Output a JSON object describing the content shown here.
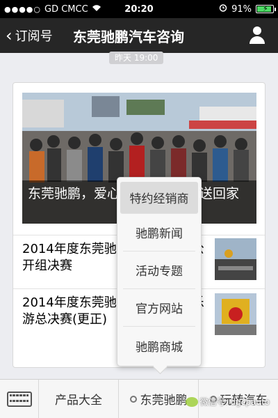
{
  "status_bar": {
    "carrier": "GD CMCC",
    "time": "20:20",
    "battery": "91%",
    "battery_level": 0.91
  },
  "nav": {
    "back_label": "订阅号",
    "title": "东莞驰鹏汽车咨询"
  },
  "timestamp": "昨天 19:00",
  "hero": {
    "caption": "东莞驰鹏，爱心车队为你平安送回家"
  },
  "news": [
    {
      "title": "2014年度东莞驰鹏汽车争霸赛公开组决赛"
    },
    {
      "title": "2014年度东莞驰鹏汽车丁车同乐游总决赛(更正)"
    }
  ],
  "popup": {
    "items": [
      "特约经销商",
      "驰鹏新闻",
      "活动专题",
      "官方网站",
      "驰鹏商城"
    ]
  },
  "tabbar": {
    "tabs": [
      "产品大全",
      "东莞驰鹏",
      "玩转汽车"
    ]
  },
  "watermark": "微信号: dgcpauto",
  "icons": [
    "signal-icon",
    "wifi-icon",
    "alarm-icon",
    "battery-icon",
    "back-chevron-icon",
    "profile-icon",
    "keyboard-icon",
    "menu-dot-icon"
  ],
  "colors": {
    "nav_bg": "#262626",
    "battery_green": "#4cd964",
    "popup_bg": "#f7f7f7"
  }
}
